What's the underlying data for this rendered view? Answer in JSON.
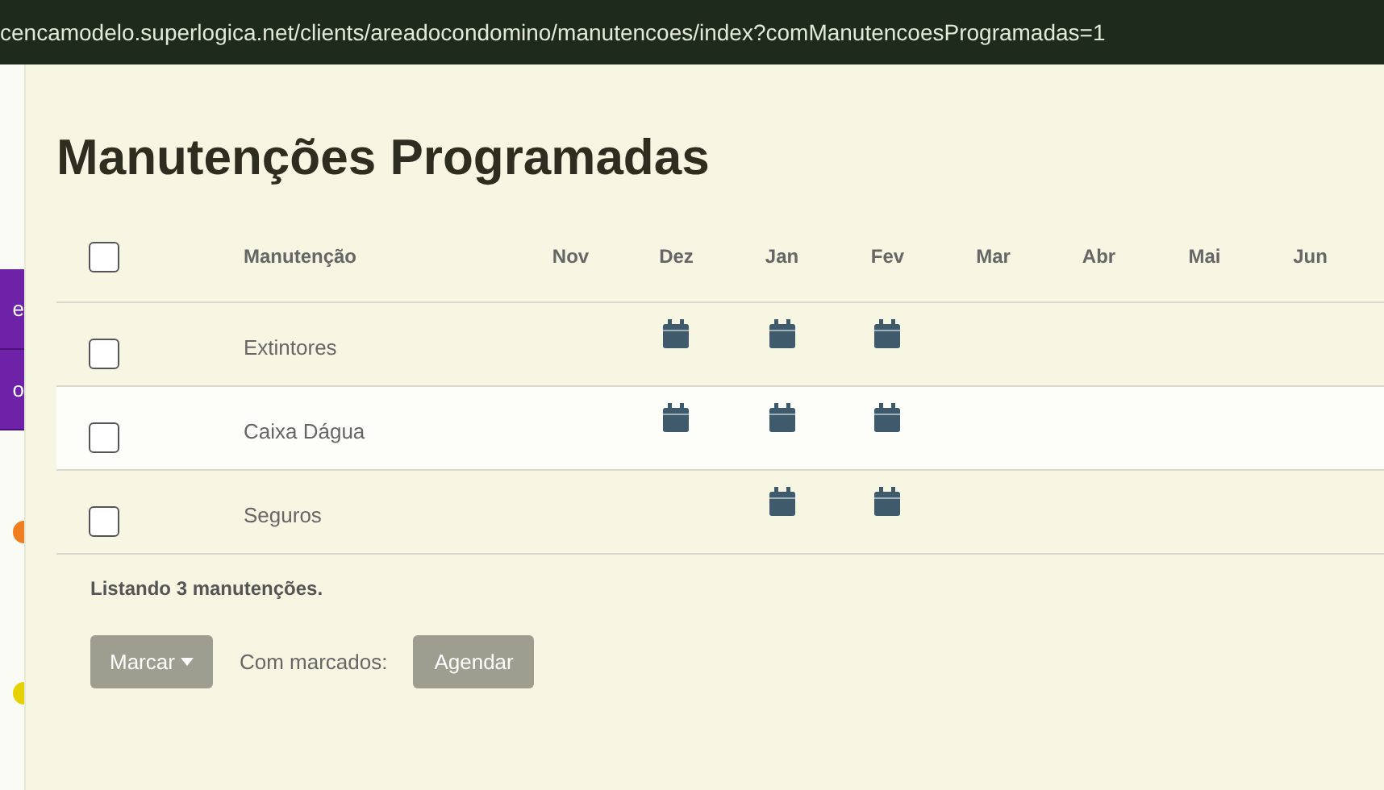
{
  "address_bar": {
    "url": "cencamodelo.superlogica.net/clients/areadocondomino/manutencoes/index?comManutencoesProgramadas=1"
  },
  "sidebar": {
    "items": [
      {
        "label": "e"
      },
      {
        "label": "o"
      }
    ],
    "dots": [
      {
        "color": "#f07d1e"
      },
      {
        "color": "#e6d200"
      }
    ]
  },
  "page_title": "Manutenções Programadas",
  "table": {
    "select_all": {
      "checked": false
    },
    "name_column": "Manutenção",
    "months": [
      "Nov",
      "Dez",
      "Jan",
      "Fev",
      "Mar",
      "Abr",
      "Mai",
      "Jun"
    ],
    "rows": [
      {
        "name": "Extintores",
        "checked": false,
        "scheduled": [
          false,
          true,
          true,
          true,
          false,
          false,
          false,
          false
        ]
      },
      {
        "name": "Caixa Dágua",
        "checked": false,
        "scheduled": [
          false,
          true,
          true,
          true,
          false,
          false,
          false,
          false
        ]
      },
      {
        "name": "Seguros",
        "checked": false,
        "scheduled": [
          false,
          false,
          true,
          true,
          false,
          false,
          false,
          false
        ]
      }
    ]
  },
  "summary": "Listando 3 manutenções.",
  "actions": {
    "mark_button": {
      "label": "Marcar",
      "disabled": true
    },
    "with_marked_label": "Com marcados:",
    "schedule_button": {
      "label": "Agendar",
      "disabled": true
    }
  }
}
